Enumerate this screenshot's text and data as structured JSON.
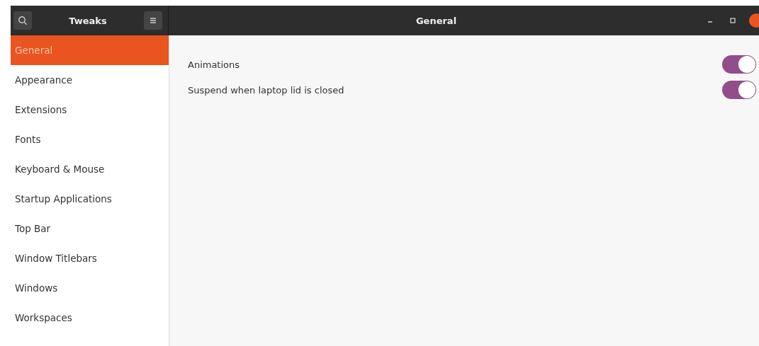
{
  "window": {
    "app_title": "Tweaks",
    "title": "General"
  },
  "sidebar": {
    "items": [
      {
        "label": "General",
        "selected": true
      },
      {
        "label": "Appearance",
        "selected": false
      },
      {
        "label": "Extensions",
        "selected": false
      },
      {
        "label": "Fonts",
        "selected": false
      },
      {
        "label": "Keyboard & Mouse",
        "selected": false
      },
      {
        "label": "Startup Applications",
        "selected": false
      },
      {
        "label": "Top Bar",
        "selected": false
      },
      {
        "label": "Window Titlebars",
        "selected": false
      },
      {
        "label": "Windows",
        "selected": false
      },
      {
        "label": "Workspaces",
        "selected": false
      }
    ]
  },
  "settings": [
    {
      "label": "Animations",
      "on": true
    },
    {
      "label": "Suspend when laptop lid is closed",
      "on": true
    }
  ]
}
